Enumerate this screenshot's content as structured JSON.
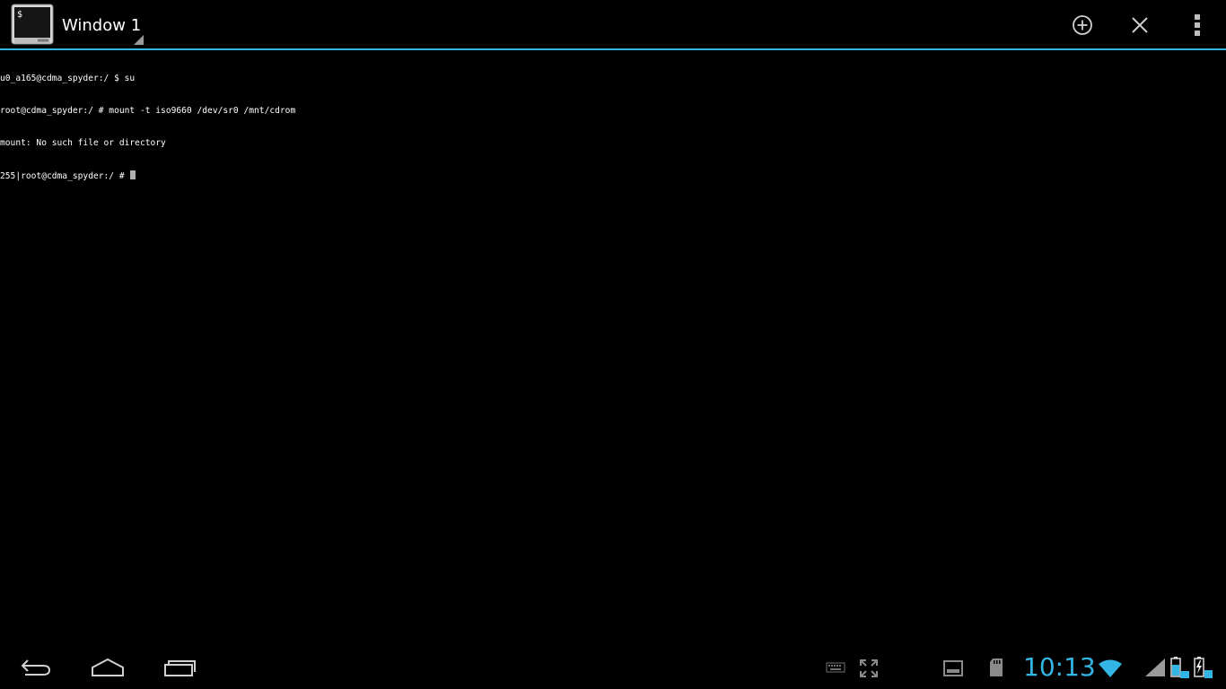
{
  "action_bar": {
    "window_title": "Window 1",
    "app_icon": "terminal-app-icon",
    "buttons": [
      {
        "name": "new-window-button",
        "icon": "plus-circle-icon"
      },
      {
        "name": "close-window-button",
        "icon": "close-icon"
      },
      {
        "name": "overflow-menu-button",
        "icon": "overflow-dots-icon"
      }
    ],
    "accent_color": "#33b5e5"
  },
  "terminal": {
    "lines": [
      "u0_a165@cdma_spyder:/ $ su",
      "root@cdma_spyder:/ # mount -t iso9660 /dev/sr0 /mnt/cdrom",
      "mount: No such file or directory",
      "255|root@cdma_spyder:/ # "
    ],
    "foreground": "#ffffff",
    "background": "#000000"
  },
  "navigation": {
    "buttons": [
      {
        "name": "back-button",
        "icon": "back-arrow-icon"
      },
      {
        "name": "home-button",
        "icon": "home-icon"
      },
      {
        "name": "recent-apps-button",
        "icon": "recent-apps-icon"
      }
    ]
  },
  "status": {
    "clock": "10:13",
    "clock_color": "#33b5e5",
    "icons": [
      "keyboard-icon",
      "fullscreen-icon",
      "screenshot-notification-icon",
      "sd-card-icon",
      "wifi-icon",
      "cell-signal-icon",
      "tablet-battery-icon",
      "dock-battery-charging-icon"
    ]
  }
}
